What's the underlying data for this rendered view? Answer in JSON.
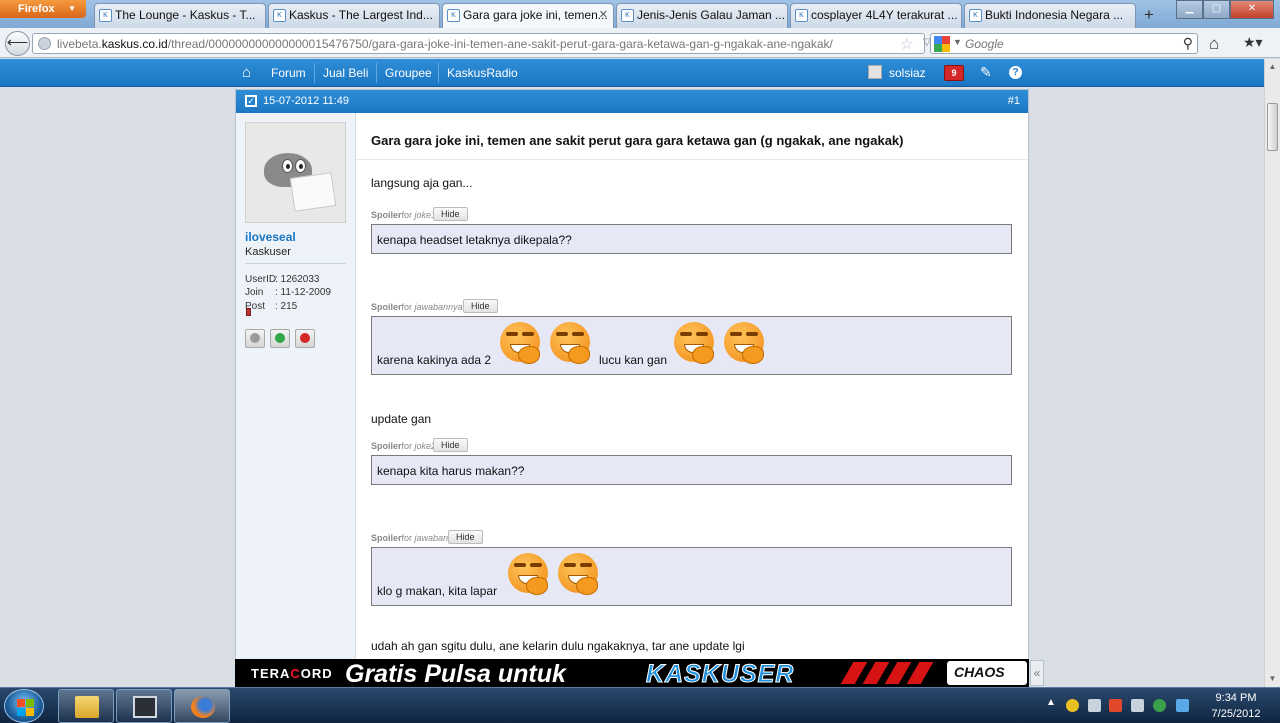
{
  "browser": {
    "menu_label": "Firefox",
    "tabs": [
      {
        "label": "The Lounge - Kaskus - T...",
        "favicon": "kaskus-icon",
        "active": false
      },
      {
        "label": "Kaskus - The Largest Ind...",
        "favicon": "kaskus-icon",
        "active": false
      },
      {
        "label": "Gara gara joke ini, temen...",
        "favicon": "kaskus-icon",
        "active": true
      },
      {
        "label": "Jenis-Jenis Galau Jaman ...",
        "favicon": "kaskus-icon",
        "active": false
      },
      {
        "label": "cosplayer 4L4Y terakurat ...",
        "favicon": "kaskus-icon",
        "active": false
      },
      {
        "label": "Bukti Indonesia Negara ...",
        "favicon": "kaskus-icon",
        "active": false
      }
    ],
    "new_tab_label": "+",
    "url": {
      "prefix": "livebeta.",
      "domain": "kaskus.co.id",
      "path": "/thread/000000000000000015476750/gara-gara-joke-ini-temen-ane-sakit-perut-gara-gara-ketawa-gan-g-ngakak-ane-ngakak/"
    },
    "search_placeholder": "Google"
  },
  "site": {
    "nav": [
      "Forum",
      "Jual Beli",
      "Groupee",
      "KaskusRadio"
    ],
    "username": "solsiaz",
    "notification_count": "9"
  },
  "post": {
    "date": "15-07-2012 11:49",
    "number": "#1",
    "title": "Gara gara joke ini, temen ane sakit perut gara gara ketawa gan (g ngakak, ane ngakak)",
    "author": {
      "name": "iloveseal",
      "rank": "Kaskuser",
      "info": [
        {
          "label": "UserID",
          "value": ": 1262033"
        },
        {
          "label": "Join",
          "value": ": 11-12-2009"
        },
        {
          "label": "Post",
          "value": ": 215"
        }
      ]
    },
    "intro": "langsung aja gan...",
    "spoiler_word": "Spoiler",
    "spoiler_for": "for",
    "hide_label": "Hide",
    "spoilers": [
      {
        "name": "joke1",
        "text": "kenapa headset letaknya dikepala??",
        "text_after": ""
      },
      {
        "name": "jawabannya",
        "text": "karena kakinya ada 2",
        "text_after": "lucu kan gan"
      },
      {
        "name": "joke2",
        "text": "kenapa kita harus makan??",
        "text_after": ""
      },
      {
        "name": "jawaban",
        "text": "klo g makan, kita lapar",
        "text_after": ""
      }
    ],
    "update_text": "update gan",
    "closing_text": "udah ah gan sgitu dulu, ane kelarin dulu ngakaknya, tar ane update lgi"
  },
  "banner": {
    "brand_prefix": "TERA",
    "brand_mid": "C",
    "brand_suffix": "ORD",
    "headline": "Gratis Pulsa untuk",
    "highlight": "KASKUSER",
    "logo_text": "CHAOS",
    "collapse_label": "«"
  },
  "taskbar": {
    "time": "9:34 PM",
    "date": "7/25/2012"
  }
}
